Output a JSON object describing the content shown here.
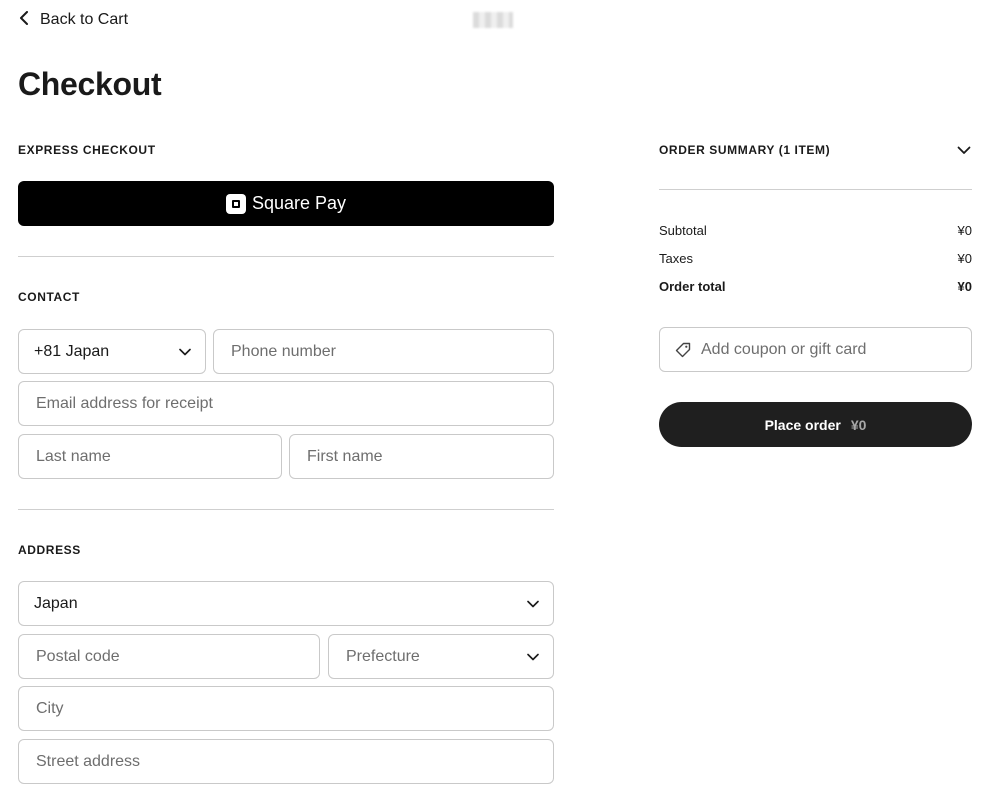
{
  "nav": {
    "back_label": "Back to Cart"
  },
  "page": {
    "title": "Checkout"
  },
  "express": {
    "section_label": "EXPRESS CHECKOUT",
    "pay_button_label": "Square Pay"
  },
  "contact": {
    "section_label": "CONTACT",
    "country_code_value": "+81 Japan",
    "phone_placeholder": "Phone number",
    "email_placeholder": "Email address for receipt",
    "last_name_placeholder": "Last name",
    "first_name_placeholder": "First name"
  },
  "address": {
    "section_label": "ADDRESS",
    "country_value": "Japan",
    "postal_placeholder": "Postal code",
    "prefecture_placeholder": "Prefecture",
    "city_placeholder": "City",
    "street_placeholder": "Street address"
  },
  "summary": {
    "header_label": "ORDER SUMMARY (1 ITEM)",
    "rows": [
      {
        "label": "Subtotal",
        "value": "¥0"
      },
      {
        "label": "Taxes",
        "value": "¥0"
      },
      {
        "label": "Order total",
        "value": "¥0"
      }
    ],
    "coupon_label": "Add coupon or gift card",
    "place_order_label": "Place order",
    "place_order_amount": "¥0"
  },
  "icons": {
    "back": "chevron-left-icon",
    "square_logo": "square-logo-icon",
    "dropdown": "chevron-down-icon",
    "coupon": "tag-icon"
  },
  "colors": {
    "primary_button": "#000000",
    "place_order_button": "#1f1f1f",
    "border": "#c9c9c9",
    "divider": "#cfcfcf"
  }
}
